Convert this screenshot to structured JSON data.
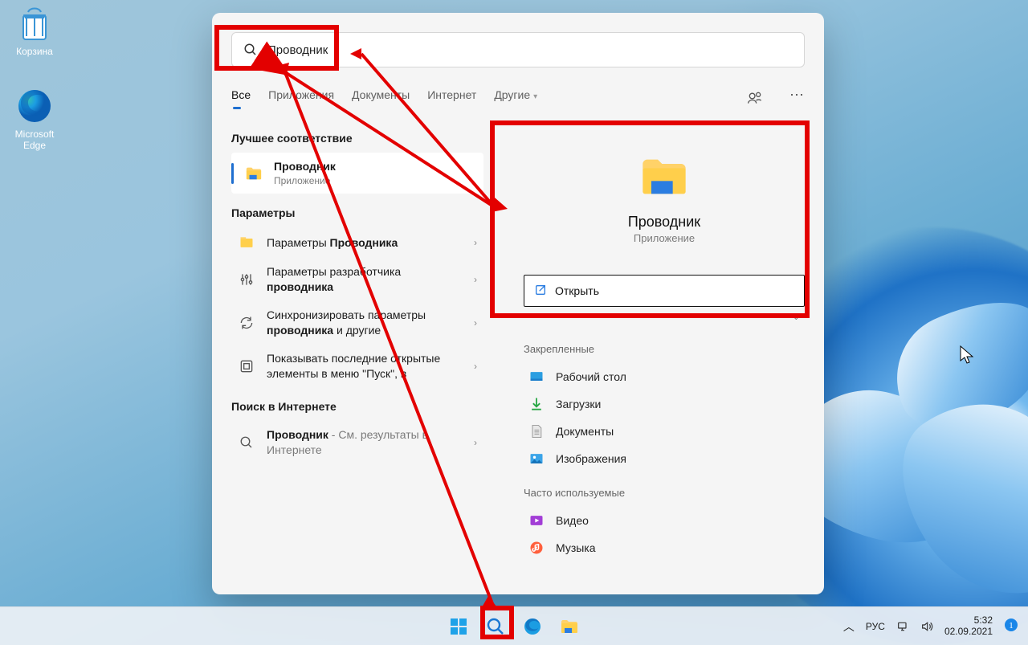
{
  "desktop": {
    "icons": {
      "recycle": "Корзина",
      "edge": "Microsoft Edge"
    }
  },
  "search": {
    "query_value": "Проводник",
    "tabs": {
      "all": "Все",
      "apps": "Приложения",
      "documents": "Документы",
      "web": "Интернет",
      "more": "Другие"
    },
    "sections": {
      "best_match": "Лучшее соответствие",
      "settings": "Параметры",
      "web_search": "Поиск в Интернете"
    },
    "best_match_item": {
      "title": "Проводник",
      "subtitle": "Приложение"
    },
    "settings_items": {
      "opts_pre": "Параметры ",
      "opts_bold": "Проводника",
      "dev_pre": "Параметры разработчика ",
      "dev_bold": "проводника",
      "sync_pre": "Синхронизировать параметры ",
      "sync_bold": "проводника",
      "sync_post": " и другие",
      "recent_pre": "Показывать последние открытые элементы в меню \"Пуск\", в"
    },
    "web_item": {
      "name": "Проводник",
      "suffix": " - См. результаты в Интернете"
    }
  },
  "preview": {
    "title": "Проводник",
    "subtitle": "Приложение",
    "open_label": "Открыть",
    "pinned_heading": "Закрепленные",
    "pinned": {
      "desktop": "Рабочий стол",
      "downloads": "Загрузки",
      "documents": "Документы",
      "pictures": "Изображения"
    },
    "frequent_heading": "Часто используемые",
    "frequent": {
      "video": "Видео",
      "music": "Музыка"
    }
  },
  "taskbar": {
    "lang": "РУС",
    "time": "5:32",
    "date": "02.09.2021"
  }
}
